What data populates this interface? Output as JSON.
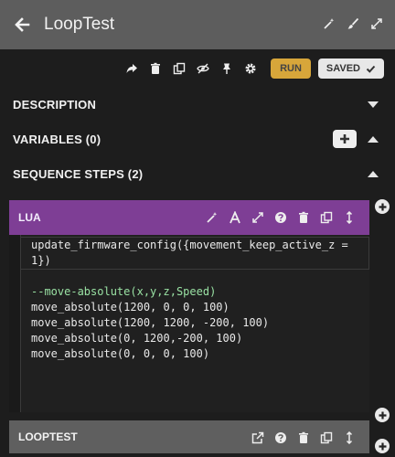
{
  "titlebar": {
    "title": "LoopTest"
  },
  "toolbar": {
    "run_label": "RUN",
    "saved_label": "SAVED"
  },
  "sections": {
    "description": "DESCRIPTION",
    "variables": "VARIABLES (0)",
    "sequence_steps": "SEQUENCE STEPS (2)"
  },
  "steps": [
    {
      "label": "LUA",
      "code_lines": [
        "update_firmware_config({movement_keep_active_z =",
        "1})",
        "",
        "--move-absolute(x,y,z,Speed)",
        "move_absolute(1200, 0, 0, 100)",
        "move_absolute(1200, 1200, -200, 100)",
        "move_absolute(0, 1200,-200, 100)",
        "move_absolute(0, 0, 0, 100)"
      ]
    },
    {
      "label": "LOOPTEST"
    }
  ],
  "colors": {
    "titlebar": "#5d5d5d",
    "background": "#1d1d1d",
    "lua_header": "#7e3e95",
    "run_button": "#d7a63a",
    "comment": "#99e1a3"
  }
}
